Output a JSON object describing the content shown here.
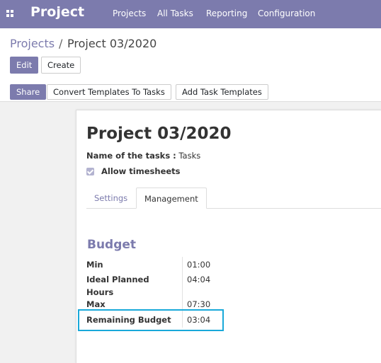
{
  "navbar": {
    "app_title": "Project",
    "menu": [
      "Projects",
      "All Tasks",
      "Reporting",
      "Configuration"
    ]
  },
  "breadcrumb": {
    "parent": "Projects",
    "separator": "/",
    "current": "Project 03/2020"
  },
  "buttons": {
    "edit": "Edit",
    "create": "Create",
    "share": "Share",
    "convert": "Convert Templates To Tasks",
    "add_templates": "Add Task Templates"
  },
  "record": {
    "title": "Project 03/2020",
    "tasks_label": "Name of the tasks :",
    "tasks_value": "Tasks",
    "allow_timesheets": "Allow timesheets",
    "allow_timesheets_checked": true
  },
  "tabs": [
    "Settings",
    "Management"
  ],
  "budget": {
    "title": "Budget",
    "rows": [
      {
        "label": "Min",
        "value": "01:00"
      },
      {
        "label": "Ideal Planned Hours",
        "value": "04:04"
      },
      {
        "label": "Max",
        "value": "07:30"
      },
      {
        "label": "Remaining Budget",
        "value": "03:04"
      }
    ]
  },
  "colors": {
    "brand": "#7c7bad",
    "highlight": "#19a9d9"
  }
}
